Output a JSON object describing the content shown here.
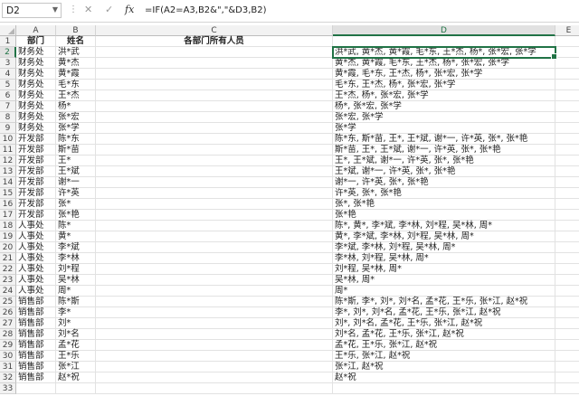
{
  "formula_bar": {
    "name_box": "D2",
    "cancel_icon": "✕",
    "enter_icon": "✓",
    "fx_label": "fx",
    "formula": "=IF(A2=A3,B2&\",\"&D3,B2)"
  },
  "columns": [
    "A",
    "B",
    "C",
    "D",
    "E"
  ],
  "selected_cell": "D2",
  "header_row": {
    "a": "部门",
    "b": "姓名",
    "c": "各部门所有人员",
    "d": ""
  },
  "rows": [
    {
      "num": "2",
      "a": "财务处",
      "b": "洪*武",
      "c": "",
      "d": "洪*武, 黄*杰, 黄*霞, 毛*东, 王*杰, 杨*, 张*宏, 张*学"
    },
    {
      "num": "3",
      "a": "财务处",
      "b": "黄*杰",
      "c": "",
      "d": "黄*杰, 黄*霞, 毛*东, 王*杰, 杨*, 张*宏, 张*学"
    },
    {
      "num": "4",
      "a": "财务处",
      "b": "黄*霞",
      "c": "",
      "d": "黄*霞, 毛*东, 王*杰, 杨*, 张*宏, 张*学"
    },
    {
      "num": "5",
      "a": "财务处",
      "b": "毛*东",
      "c": "",
      "d": "毛*东, 王*杰, 杨*, 张*宏, 张*学"
    },
    {
      "num": "6",
      "a": "财务处",
      "b": "王*杰",
      "c": "",
      "d": "王*杰, 杨*, 张*宏, 张*学"
    },
    {
      "num": "7",
      "a": "财务处",
      "b": "杨*",
      "c": "",
      "d": "杨*, 张*宏, 张*学"
    },
    {
      "num": "8",
      "a": "财务处",
      "b": "张*宏",
      "c": "",
      "d": "张*宏, 张*学"
    },
    {
      "num": "9",
      "a": "财务处",
      "b": "张*学",
      "c": "",
      "d": "张*学"
    },
    {
      "num": "10",
      "a": "开发部",
      "b": "陈*东",
      "c": "",
      "d": "陈*东, 斯*苗, 王*, 王*斌, 谢*一, 许*英, 张*, 张*艳"
    },
    {
      "num": "11",
      "a": "开发部",
      "b": "斯*苗",
      "c": "",
      "d": "斯*苗, 王*, 王*斌, 谢*一, 许*英, 张*, 张*艳"
    },
    {
      "num": "12",
      "a": "开发部",
      "b": "王*",
      "c": "",
      "d": "王*, 王*斌, 谢*一, 许*英, 张*, 张*艳"
    },
    {
      "num": "13",
      "a": "开发部",
      "b": "王*斌",
      "c": "",
      "d": "王*斌, 谢*一, 许*英, 张*, 张*艳"
    },
    {
      "num": "14",
      "a": "开发部",
      "b": "谢*一",
      "c": "",
      "d": "谢*一, 许*英, 张*, 张*艳"
    },
    {
      "num": "15",
      "a": "开发部",
      "b": "许*英",
      "c": "",
      "d": "许*英, 张*, 张*艳"
    },
    {
      "num": "16",
      "a": "开发部",
      "b": "张*",
      "c": "",
      "d": "张*, 张*艳"
    },
    {
      "num": "17",
      "a": "开发部",
      "b": "张*艳",
      "c": "",
      "d": "张*艳"
    },
    {
      "num": "18",
      "a": "人事处",
      "b": "陈*",
      "c": "",
      "d": "陈*, 黄*, 李*斌, 李*林, 刘*程, 吴*林, 周*"
    },
    {
      "num": "19",
      "a": "人事处",
      "b": "黄*",
      "c": "",
      "d": "黄*, 李*斌, 李*林, 刘*程, 吴*林, 周*"
    },
    {
      "num": "20",
      "a": "人事处",
      "b": "李*斌",
      "c": "",
      "d": "李*斌, 李*林, 刘*程, 吴*林, 周*"
    },
    {
      "num": "21",
      "a": "人事处",
      "b": "李*林",
      "c": "",
      "d": "李*林, 刘*程, 吴*林, 周*"
    },
    {
      "num": "22",
      "a": "人事处",
      "b": "刘*程",
      "c": "",
      "d": "刘*程, 吴*林, 周*"
    },
    {
      "num": "23",
      "a": "人事处",
      "b": "吴*林",
      "c": "",
      "d": "吴*林, 周*"
    },
    {
      "num": "24",
      "a": "人事处",
      "b": "周*",
      "c": "",
      "d": "周*"
    },
    {
      "num": "25",
      "a": "销售部",
      "b": "陈*斯",
      "c": "",
      "d": "陈*斯, 李*, 刘*, 刘*名, 孟*花, 王*乐, 张*江, 赵*祝"
    },
    {
      "num": "26",
      "a": "销售部",
      "b": "李*",
      "c": "",
      "d": "李*, 刘*, 刘*名, 孟*花, 王*乐, 张*江, 赵*祝"
    },
    {
      "num": "27",
      "a": "销售部",
      "b": "刘*",
      "c": "",
      "d": "刘*, 刘*名, 孟*花, 王*乐, 张*江, 赵*祝"
    },
    {
      "num": "28",
      "a": "销售部",
      "b": "刘*名",
      "c": "",
      "d": "刘*名, 孟*花, 王*乐, 张*江, 赵*祝"
    },
    {
      "num": "29",
      "a": "销售部",
      "b": "孟*花",
      "c": "",
      "d": "孟*花, 王*乐, 张*江, 赵*祝"
    },
    {
      "num": "30",
      "a": "销售部",
      "b": "王*乐",
      "c": "",
      "d": "王*乐, 张*江, 赵*祝"
    },
    {
      "num": "31",
      "a": "销售部",
      "b": "张*江",
      "c": "",
      "d": "张*江, 赵*祝"
    },
    {
      "num": "32",
      "a": "销售部",
      "b": "赵*祝",
      "c": "",
      "d": "赵*祝"
    },
    {
      "num": "33",
      "a": "",
      "b": "",
      "c": "",
      "d": ""
    }
  ]
}
